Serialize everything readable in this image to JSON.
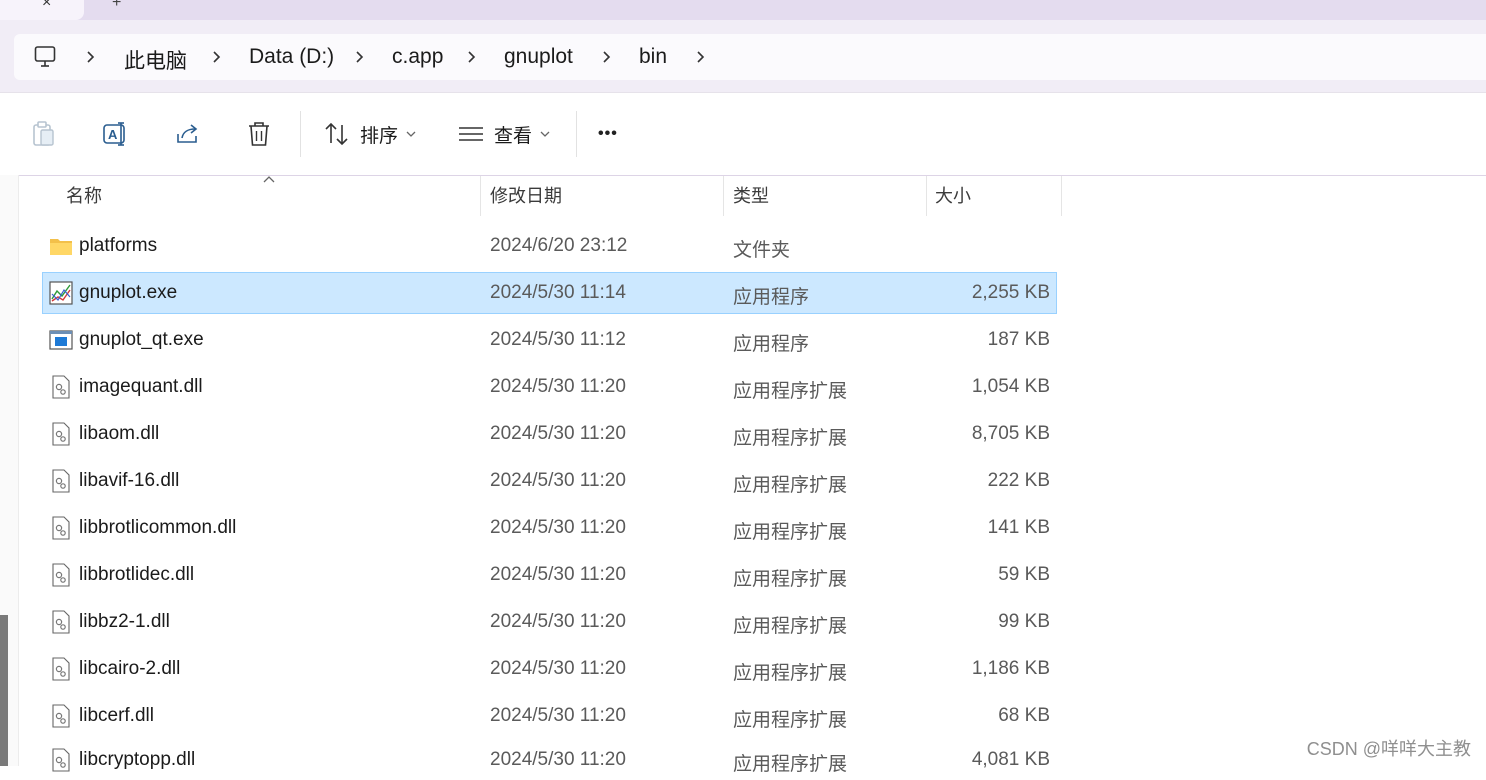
{
  "tabs": {
    "close_glyph": "×",
    "add_glyph": "+"
  },
  "breadcrumb": [
    "此电脑",
    "Data (D:)",
    "c.app",
    "gnuplot",
    "bin"
  ],
  "toolbar": {
    "sort_label": "排序",
    "view_label": "查看",
    "more_label": "•••"
  },
  "columns": {
    "name": "名称",
    "date": "修改日期",
    "type": "类型",
    "size": "大小"
  },
  "files": [
    {
      "name": "platforms",
      "date": "2024/6/20 23:12",
      "type": "文件夹",
      "size": "",
      "icon": "folder-icon"
    },
    {
      "name": "gnuplot.exe",
      "date": "2024/5/30 11:14",
      "type": "应用程序",
      "size": "2,255 KB",
      "icon": "gnuplot-app-icon",
      "selected": true
    },
    {
      "name": "gnuplot_qt.exe",
      "date": "2024/5/30 11:12",
      "type": "应用程序",
      "size": "187 KB",
      "icon": "app-window-icon"
    },
    {
      "name": "imagequant.dll",
      "date": "2024/5/30 11:20",
      "type": "应用程序扩展",
      "size": "1,054 KB",
      "icon": "dll-file-icon"
    },
    {
      "name": "libaom.dll",
      "date": "2024/5/30 11:20",
      "type": "应用程序扩展",
      "size": "8,705 KB",
      "icon": "dll-file-icon"
    },
    {
      "name": "libavif-16.dll",
      "date": "2024/5/30 11:20",
      "type": "应用程序扩展",
      "size": "222 KB",
      "icon": "dll-file-icon"
    },
    {
      "name": "libbrotlicommon.dll",
      "date": "2024/5/30 11:20",
      "type": "应用程序扩展",
      "size": "141 KB",
      "icon": "dll-file-icon"
    },
    {
      "name": "libbrotlidec.dll",
      "date": "2024/5/30 11:20",
      "type": "应用程序扩展",
      "size": "59 KB",
      "icon": "dll-file-icon"
    },
    {
      "name": "libbz2-1.dll",
      "date": "2024/5/30 11:20",
      "type": "应用程序扩展",
      "size": "99 KB",
      "icon": "dll-file-icon"
    },
    {
      "name": "libcairo-2.dll",
      "date": "2024/5/30 11:20",
      "type": "应用程序扩展",
      "size": "1,186 KB",
      "icon": "dll-file-icon"
    },
    {
      "name": "libcerf.dll",
      "date": "2024/5/30 11:20",
      "type": "应用程序扩展",
      "size": "68 KB",
      "icon": "dll-file-icon"
    },
    {
      "name": "libcryptopp.dll",
      "date": "2024/5/30 11:20",
      "type": "应用程序扩展",
      "size": "4,081 KB",
      "icon": "dll-file-icon"
    }
  ],
  "watermark": "CSDN @咩咩大主教",
  "colors": {
    "selection": "#cce8ff",
    "selection_border": "#99d1ff",
    "accent": "#0067c0"
  }
}
